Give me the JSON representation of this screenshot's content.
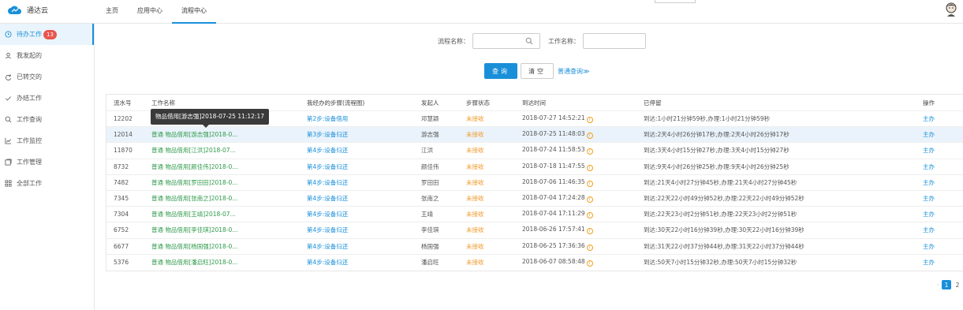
{
  "app": {
    "name": "通达云"
  },
  "nav": {
    "tabs": [
      "主页",
      "应用中心",
      "流程中心"
    ],
    "active": 2
  },
  "sidebar": {
    "items": [
      {
        "label": "待办工作",
        "badge": "13",
        "icon": "clock-icon"
      },
      {
        "label": "我发起的",
        "icon": "person-icon"
      },
      {
        "label": "已转交的",
        "icon": "transfer-icon"
      },
      {
        "label": "办结工作",
        "icon": "check-icon"
      },
      {
        "label": "工作查询",
        "icon": "search-icon"
      },
      {
        "label": "工作监控",
        "icon": "chart-icon"
      },
      {
        "label": "工作管理",
        "icon": "folder-icon"
      },
      {
        "label": "全部工作",
        "icon": "grid-icon"
      }
    ]
  },
  "search": {
    "flow_label": "流程名称：",
    "work_label": "工作名称："
  },
  "buttons": {
    "query": "查询",
    "clear": "清空",
    "advanced": "普通查询≫"
  },
  "table": {
    "headers": [
      "流水号",
      "工作名称",
      "我经办的步骤(流程图)",
      "发起人",
      "步骤状态",
      "到达时间",
      "已停留",
      "操作"
    ],
    "rows": [
      {
        "id": "12202",
        "name": "",
        "step": "第2步:设备借用",
        "initiator": "邓慧颖",
        "status": "未接收",
        "time": "2018-07-27 14:52:21",
        "stay": "到达:1小时21分钟59秒,办理:1小时21分钟59秒",
        "op": "主办"
      },
      {
        "id": "12014",
        "name": "普通 物品借用[游志强]2018-0...",
        "step": "第3步:设备归还",
        "initiator": "游志强",
        "status": "未接收",
        "time": "2018-07-25 11:48:03",
        "stay": "到达:2天4小时26分钟17秒,办理:2天4小时26分钟17秒",
        "op": "主办"
      },
      {
        "id": "11870",
        "name": "普通 物品借用[江洪]2018-07...",
        "step": "第4步:设备归还",
        "initiator": "江洪",
        "status": "未接收",
        "time": "2018-07-24 11:58:53",
        "stay": "到达:3天4小时15分钟27秒,办理:3天4小时15分钟27秒",
        "op": "主办"
      },
      {
        "id": "8732",
        "name": "普通 物品借用[颜佳伟]2018-0...",
        "step": "第4步:设备归还",
        "initiator": "颜佳伟",
        "status": "未接收",
        "time": "2018-07-18 11:47:55",
        "stay": "到达:9天4小时26分钟25秒,办理:9天4小时26分钟25秒",
        "op": "主办"
      },
      {
        "id": "7482",
        "name": "普通 物品借用[罗田田]2018-0...",
        "step": "第4步:设备归还",
        "initiator": "罗田田",
        "status": "未接收",
        "time": "2018-07-06 11:46:35",
        "stay": "到达:21天4小时27分钟45秒,办理:21天4小时27分钟45秒",
        "op": "主办"
      },
      {
        "id": "7345",
        "name": "普通 物品借用[张南之]2018-0...",
        "step": "第4步:设备归还",
        "initiator": "张南之",
        "status": "未接收",
        "time": "2018-07-04 17:24:28",
        "stay": "到达:22天22小时49分钟52秒,办理:22天22小时49分钟52秒",
        "op": "主办"
      },
      {
        "id": "7304",
        "name": "普通 物品借用[王靖]2018-07...",
        "step": "第4步:设备归还",
        "initiator": "王靖",
        "status": "未接收",
        "time": "2018-07-04 17:11:29",
        "stay": "到达:22天23小时2分钟51秒,办理:22天23小时2分钟51秒",
        "op": "主办"
      },
      {
        "id": "6752",
        "name": "普通 物品借用[李佳琪]2018-0...",
        "step": "第4步:设备归还",
        "initiator": "李佳琪",
        "status": "未接收",
        "time": "2018-06-26 17:57:41",
        "stay": "到达:30天22小时16分钟39秒,办理:30天22小时16分钟39秒",
        "op": "主办"
      },
      {
        "id": "6677",
        "name": "普通 物品借用[杨国强]2018-0...",
        "step": "第4步:设备归还",
        "initiator": "杨国强",
        "status": "未接收",
        "time": "2018-06-25 17:36:36",
        "stay": "到达:31天22小时37分钟44秒,办理:31天22小时37分钟44秒",
        "op": "主办"
      },
      {
        "id": "5376",
        "name": "普通 物品借用[潘启旺]2018-0...",
        "step": "第4步:设备归还",
        "initiator": "潘启旺",
        "status": "未接收",
        "time": "2018-06-07 08:58:48",
        "stay": "到达:50天7小时15分钟32秒,办理:50天7小时15分钟32秒",
        "op": "主办"
      }
    ],
    "highlight_row": 1
  },
  "tooltip": {
    "text": "物品借用[游志强]2018-07-25 11:12:17"
  },
  "pager": {
    "pages": [
      "1",
      "2"
    ],
    "current": "1"
  },
  "colors": {
    "accent": "#1a8fd9",
    "green_link": "#2e9a4a",
    "status_orange": "#f19a2a",
    "badge_red": "#e8554e"
  }
}
